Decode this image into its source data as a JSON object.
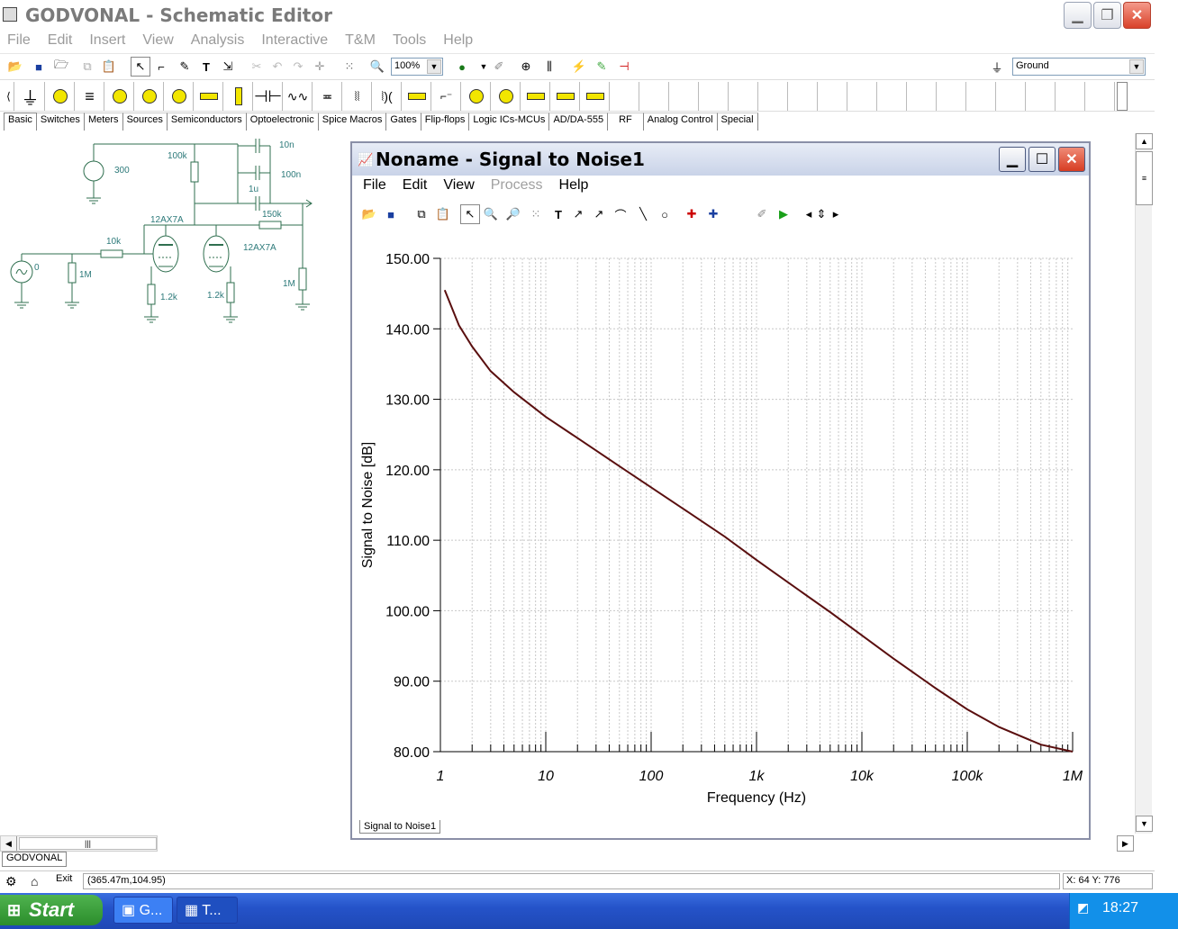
{
  "app": {
    "title": "GODVONAL - Schematic Editor",
    "menu": [
      "File",
      "Edit",
      "Insert",
      "View",
      "Analysis",
      "Interactive",
      "T&M",
      "Tools",
      "Help"
    ]
  },
  "toolbar": {
    "zoom_value": "100%",
    "ground_combo": "Ground"
  },
  "palette": {
    "tabs": [
      "Basic",
      "Switches",
      "Meters",
      "Sources",
      "Semiconductors",
      "Optoelectronic",
      "Spice Macros",
      "Gates",
      "Flip-flops",
      "Logic ICs-MCUs",
      "AD/DA-555",
      "RF",
      "Analog Control",
      "Special"
    ]
  },
  "schematic": {
    "labels": {
      "v_source": "300",
      "r_plate": "100k",
      "c1": "10n",
      "c2": "100n",
      "c3": "1u",
      "r_out": "150k",
      "tube1": "12AX7A",
      "tube2": "12AX7A",
      "r_in": "10k",
      "gen": "0",
      "r_grid": "1M",
      "rk1": "1.2k",
      "rk2": "1.2k",
      "r_load": "1M"
    }
  },
  "analysis": {
    "title": "Noname - Signal to Noise1",
    "menu": [
      "File",
      "Edit",
      "View",
      "Process",
      "Help"
    ],
    "tab_label": "Signal to Noise1"
  },
  "chart_data": {
    "type": "line",
    "xlabel": "Frequency (Hz)",
    "ylabel": "Signal to Noise [dB]",
    "xscale": "log",
    "xlim": [
      1,
      1000000
    ],
    "ylim": [
      80,
      150
    ],
    "x_ticks": [
      "1",
      "10",
      "100",
      "1k",
      "10k",
      "100k",
      "1M"
    ],
    "y_ticks": [
      "150.00",
      "140.00",
      "130.00",
      "120.00",
      "110.00",
      "100.00",
      "90.00",
      "80.00"
    ],
    "grid": true,
    "series": [
      {
        "color": "#5a0f0f",
        "x": [
          1.1,
          1.5,
          2,
          3,
          5,
          10,
          20,
          50,
          100,
          200,
          500,
          1000,
          2000,
          5000,
          10000,
          20000,
          50000,
          100000,
          200000,
          500000,
          1000000
        ],
        "y": [
          145.5,
          140.5,
          137.5,
          134.0,
          131.0,
          127.5,
          124.5,
          120.5,
          117.5,
          114.5,
          110.5,
          107.2,
          104.0,
          99.8,
          96.5,
          93.2,
          89.0,
          86.0,
          83.5,
          81.0,
          80.0
        ]
      }
    ]
  },
  "status": {
    "coords": "(365.47m,104.95)",
    "xy": "X: 64  Y: 776",
    "doc_tab": "GODVONAL",
    "exit": "Exit"
  },
  "taskbar": {
    "start": "Start",
    "task1": "G...",
    "task2": "T...",
    "clock": "18:27"
  }
}
